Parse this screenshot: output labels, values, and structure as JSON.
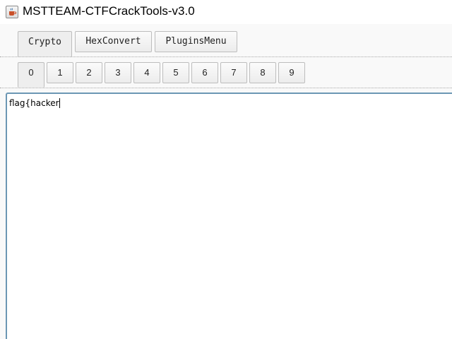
{
  "window": {
    "title": "MSTTEAM-CTFCrackTools-v3.0",
    "icon": "java-cup-icon"
  },
  "main_tabs": [
    {
      "label": "Crypto",
      "selected": true
    },
    {
      "label": "HexConvert",
      "selected": false
    },
    {
      "label": "PluginsMenu",
      "selected": false
    }
  ],
  "number_tabs": [
    {
      "label": "0",
      "selected": true
    },
    {
      "label": "1",
      "selected": false
    },
    {
      "label": "2",
      "selected": false
    },
    {
      "label": "3",
      "selected": false
    },
    {
      "label": "4",
      "selected": false
    },
    {
      "label": "5",
      "selected": false
    },
    {
      "label": "6",
      "selected": false
    },
    {
      "label": "7",
      "selected": false
    },
    {
      "label": "8",
      "selected": false
    },
    {
      "label": "9",
      "selected": false
    }
  ],
  "editor": {
    "value": "flag{hacker"
  },
  "colors": {
    "editor_border": "#6c97b4",
    "tab_border": "#bdbdbd",
    "background": "#f9f9f9"
  }
}
